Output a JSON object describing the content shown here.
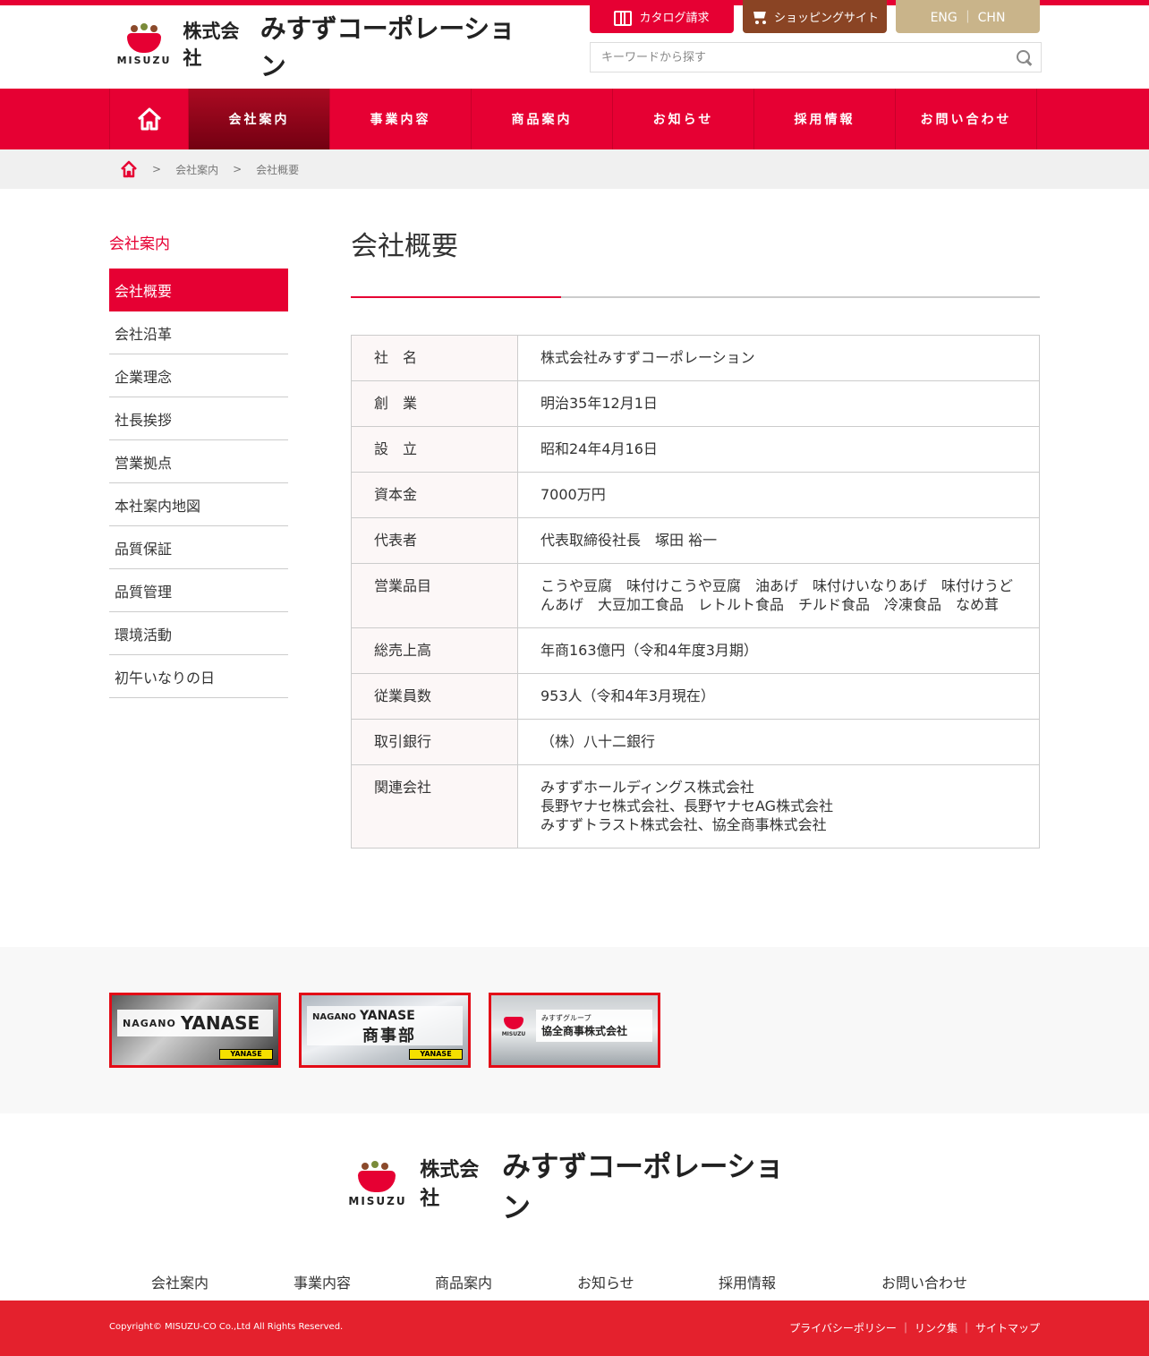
{
  "brand": {
    "mark_text": "MISUZU",
    "kk": "株式会社",
    "name": "みすずコーポレーション"
  },
  "header": {
    "catalog_label": "カタログ請求",
    "shop_label": "ショッピングサイト",
    "lang_label": "ENG ｜ CHN",
    "search_placeholder": "キーワードから探す"
  },
  "nav": {
    "items": [
      "会社案内",
      "事業内容",
      "商品案内",
      "お知らせ",
      "採用情報",
      "お問い合わせ"
    ],
    "active": "会社案内"
  },
  "breadcrumb": {
    "sep": ">",
    "items": [
      "会社案内",
      "会社概要"
    ]
  },
  "sidebar": {
    "title": "会社案内",
    "items": [
      "会社概要",
      "会社沿革",
      "企業理念",
      "社長挨拶",
      "営業拠点",
      "本社案内地図",
      "品質保証",
      "品質管理",
      "環境活動",
      "初午いなりの日"
    ]
  },
  "main": {
    "title": "会社概要",
    "rows": [
      {
        "label": "社　名",
        "value": "株式会社みすずコーポレーション"
      },
      {
        "label": "創　業",
        "value": "明治35年12月1日"
      },
      {
        "label": "設　立",
        "value": "昭和24年4月16日"
      },
      {
        "label": "資本金",
        "value": "7000万円"
      },
      {
        "label": "代表者",
        "value": "代表取締役社長　塚田 裕一"
      },
      {
        "label": "営業品目",
        "value": "こうや豆腐　味付けこうや豆腐　油あげ　味付けいなりあげ　味付けうどんあげ　大豆加工食品　レトルト食品　チルド食品　冷凍食品　なめ茸"
      },
      {
        "label": "総売上高",
        "value": "年商163億円（令和4年度3月期）"
      },
      {
        "label": "従業員数",
        "value": "953人（令和4年3月現在）"
      },
      {
        "label": "取引銀行",
        "value": "（株）八十二銀行"
      },
      {
        "label": "関連会社",
        "value": "みすずホールディングス株式会社\n長野ヤナセ株式会社、長野ヤナセAG株式会社\nみすずトラスト株式会社、協全商事株式会社"
      }
    ]
  },
  "banners": {
    "b1": {
      "small": "NAGANO",
      "big": "YANASE",
      "badge": "YANASE"
    },
    "b2": {
      "small": "NAGANO",
      "big": "YANASE",
      "sub": "商事部",
      "badge": "YANASE"
    },
    "b3": {
      "mark_text": "MISUZU",
      "group": "みすずグループ",
      "name": "協全商事株式会社"
    }
  },
  "footer": {
    "nav": [
      "会社案内",
      "事業内容",
      "商品案内",
      "お知らせ",
      "採用情報",
      "お問い合わせ"
    ],
    "copyright": "Copyright© MISUZU-CO Co.,Ltd All Rights Reserved.",
    "links": [
      "プライバシーポリシー",
      "リンク集",
      "サイトマップ"
    ],
    "link_sep": "｜"
  },
  "colors": {
    "brand_red": "#e60033",
    "shop_brown": "#8a4424",
    "lang_beige": "#c9b48a",
    "footer_red": "#e4212d"
  }
}
